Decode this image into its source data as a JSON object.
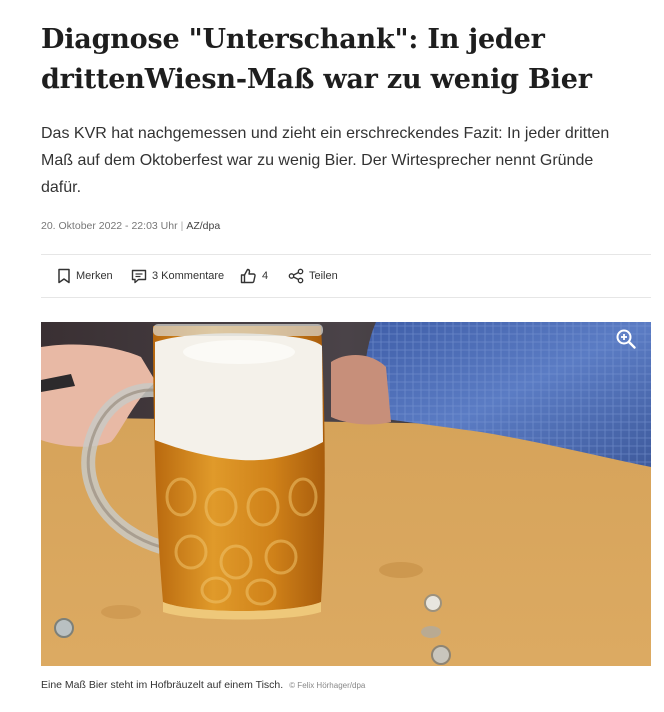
{
  "article": {
    "headline": "Diagnose \"Unterschank\": In jeder drittenWiesn-Maß war zu wenig Bier",
    "lead": "Das KVR hat nachgemessen und zieht ein erschreckendes Fazit: In jeder dritten Maß auf dem Oktoberfest war zu wenig Bier. Der Wirtesprecher nennt Gründe dafür.",
    "date": "20. Oktober 2022 - 22:03 Uhr",
    "separator": "|",
    "author": "AZ/dpa"
  },
  "actions": {
    "merken": {
      "label": "Merken",
      "icon": "bookmark-icon"
    },
    "kommentare": {
      "label": "3 Kommentare",
      "icon": "comment-icon"
    },
    "likes": {
      "label": "4",
      "icon": "thumbs-up-icon"
    },
    "teilen": {
      "label": "Teilen",
      "icon": "share-icon"
    }
  },
  "image": {
    "zoom_icon": "zoom-in-icon",
    "caption": "Eine Maß Bier steht im Hofbräuzelt auf einem Tisch.",
    "credit": "© Felix Hörhager/dpa"
  },
  "colors": {
    "text": "#1e1e1e",
    "meta": "#777777",
    "table": "#d9a55a",
    "beer": "#d48a1e",
    "foam": "#f4f1ea",
    "sleeve": "#4f6fb5"
  }
}
